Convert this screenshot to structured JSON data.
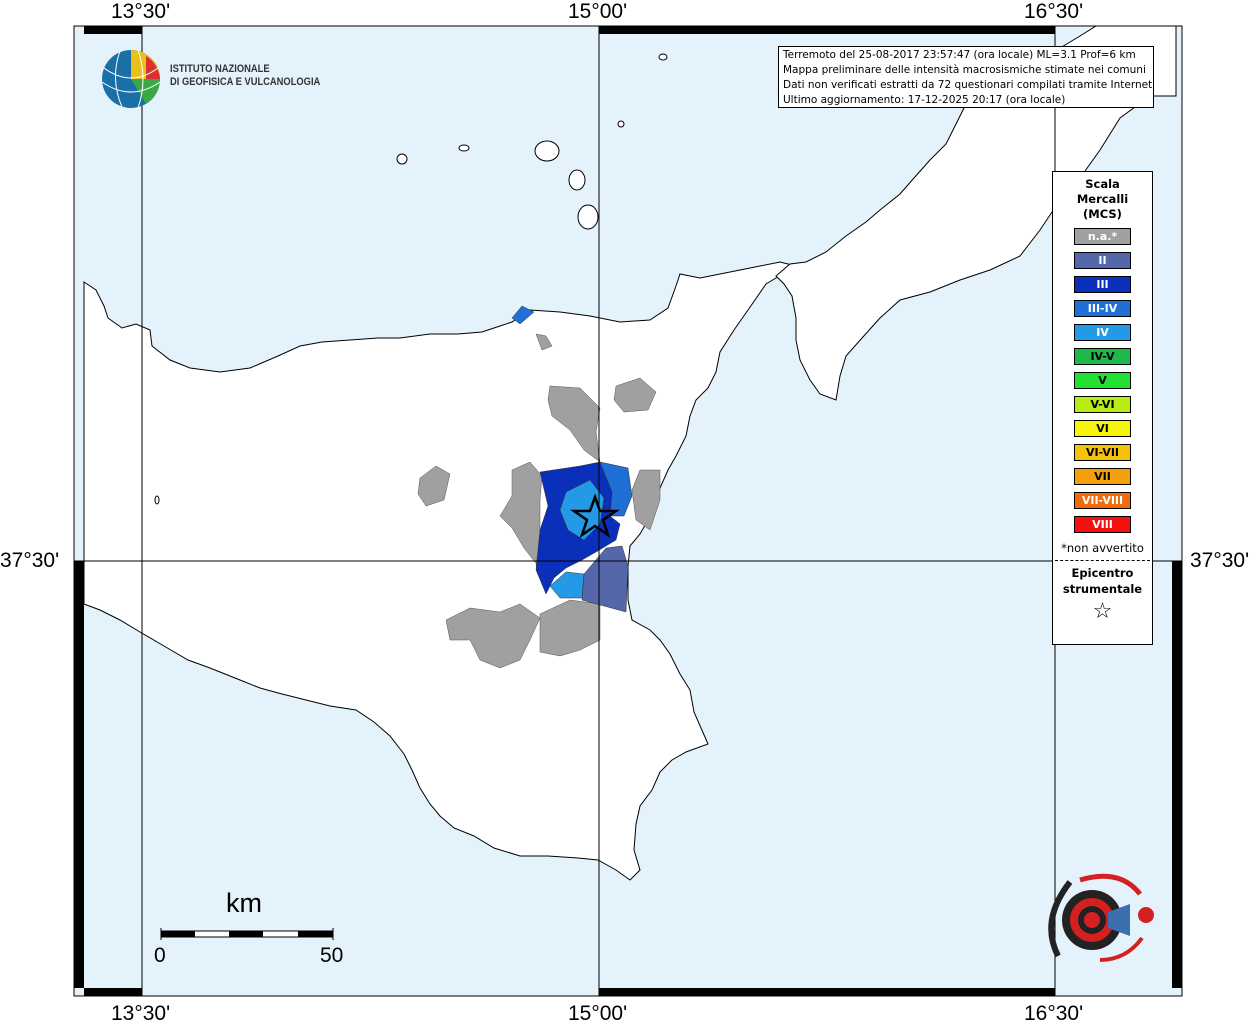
{
  "coords": {
    "top": [
      "13°30'",
      "15°00'",
      "16°30'"
    ],
    "bottom": [
      "13°30'",
      "15°00'",
      "16°30'"
    ],
    "left": "37°30'",
    "right": "37°30'"
  },
  "logo": {
    "line1": "ISTITUTO NAZIONALE",
    "line2": "DI GEOFISICA E VULCANOLOGIA"
  },
  "info": {
    "line1": "Terremoto del 25-08-2017 23:57:47 (ora locale) ML=3.1 Prof=6 km",
    "line2": "Mappa preliminare delle intensità macrosismiche stimate nei comuni",
    "line3": "Dati non verificati estratti da 72 questionari compilati tramite Internet.",
    "line4": "Ultimo aggiornamento: 17-12-2025 20:17 (ora locale)"
  },
  "legend": {
    "title1": "Scala",
    "title2": "Mercalli",
    "title3": "(MCS)",
    "items": [
      {
        "label": "n.a.*",
        "color": "#a0a0a0"
      },
      {
        "label": "II",
        "color": "#5566aa"
      },
      {
        "label": "III",
        "color": "#0a2fb8"
      },
      {
        "label": "III-IV",
        "color": "#1f6fd6"
      },
      {
        "label": "IV",
        "color": "#2499e6"
      },
      {
        "label": "IV-V",
        "color": "#1fb84a"
      },
      {
        "label": "V",
        "color": "#22e033"
      },
      {
        "label": "V-VI",
        "color": "#b7ec14"
      },
      {
        "label": "VI",
        "color": "#f5f50a"
      },
      {
        "label": "VI-VII",
        "color": "#f5c20a"
      },
      {
        "label": "VII",
        "color": "#f5a00a"
      },
      {
        "label": "VII-VIII",
        "color": "#f26a0a"
      },
      {
        "label": "VIII",
        "color": "#f51010"
      }
    ],
    "note": "*non avvertito",
    "epi1": "Epicentro",
    "epi2": "strumentale",
    "star": "☆"
  },
  "scalebar": {
    "unit": "km",
    "min": "0",
    "max": "50"
  },
  "colors": {
    "sea": "#e4f2fc",
    "land": "#ffffff",
    "na": "#a0a0a0"
  }
}
